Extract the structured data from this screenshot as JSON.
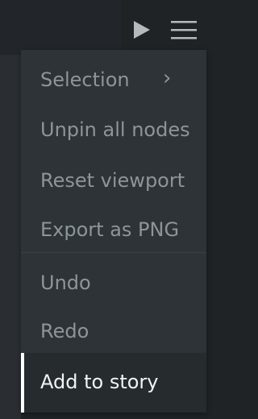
{
  "toolbar": {
    "play_icon": "play-icon",
    "menu_icon": "hamburger-menu-icon"
  },
  "menu": {
    "items": [
      {
        "label": "Selection",
        "has_submenu": true
      },
      {
        "label": "Unpin all nodes"
      },
      {
        "label": "Reset viewport"
      },
      {
        "label": "Export as PNG"
      },
      {
        "label": "Undo"
      },
      {
        "label": "Redo"
      },
      {
        "label": "Add to story",
        "active": true
      }
    ],
    "chevron": "›"
  },
  "colors": {
    "background": "#1f2326",
    "menu_background": "#2d3337",
    "text_muted": "#8e9599",
    "text_active": "#f1f3f4",
    "active_indicator": "#ffffff"
  }
}
